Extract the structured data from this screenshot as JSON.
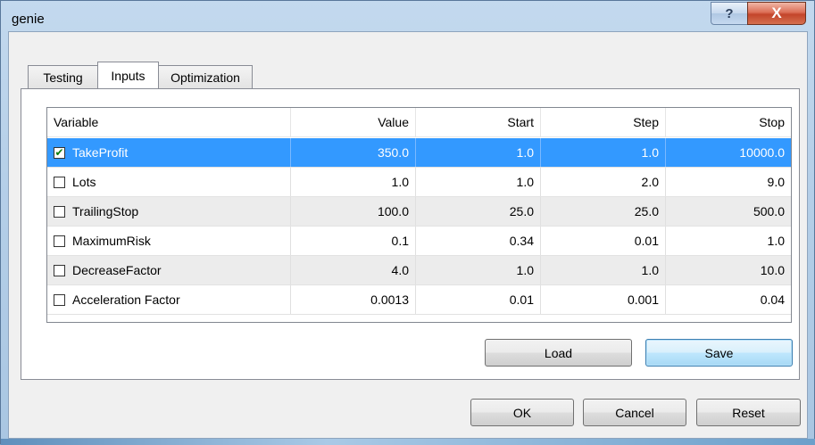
{
  "window": {
    "title": "genie"
  },
  "titlebar": {
    "help_glyph": "?",
    "close_glyph": "X"
  },
  "tabs": [
    {
      "label": "Testing",
      "active": false
    },
    {
      "label": "Inputs",
      "active": true
    },
    {
      "label": "Optimization",
      "active": false
    }
  ],
  "grid": {
    "headers": [
      "Variable",
      "Value",
      "Start",
      "Step",
      "Stop"
    ],
    "rows": [
      {
        "checked": true,
        "name": "TakeProfit",
        "value": "350.0",
        "start": "1.0",
        "step": "1.0",
        "stop": "10000.0"
      },
      {
        "checked": false,
        "name": "Lots",
        "value": "1.0",
        "start": "1.0",
        "step": "2.0",
        "stop": "9.0"
      },
      {
        "checked": false,
        "name": "TrailingStop",
        "value": "100.0",
        "start": "25.0",
        "step": "25.0",
        "stop": "500.0"
      },
      {
        "checked": false,
        "name": "MaximumRisk",
        "value": "0.1",
        "start": "0.34",
        "step": "0.01",
        "stop": "1.0"
      },
      {
        "checked": false,
        "name": "DecreaseFactor",
        "value": "4.0",
        "start": "1.0",
        "step": "1.0",
        "stop": "10.0"
      },
      {
        "checked": false,
        "name": "Acceleration Factor",
        "value": "0.0013",
        "start": "0.01",
        "step": "0.001",
        "stop": "0.04"
      }
    ]
  },
  "panel_buttons": {
    "load": "Load",
    "save": "Save"
  },
  "dialog_buttons": {
    "ok": "OK",
    "cancel": "Cancel",
    "reset": "Reset"
  },
  "colors": {
    "selection": "#3399ff",
    "check": "#0a7a0a",
    "close": "#c3452b"
  }
}
